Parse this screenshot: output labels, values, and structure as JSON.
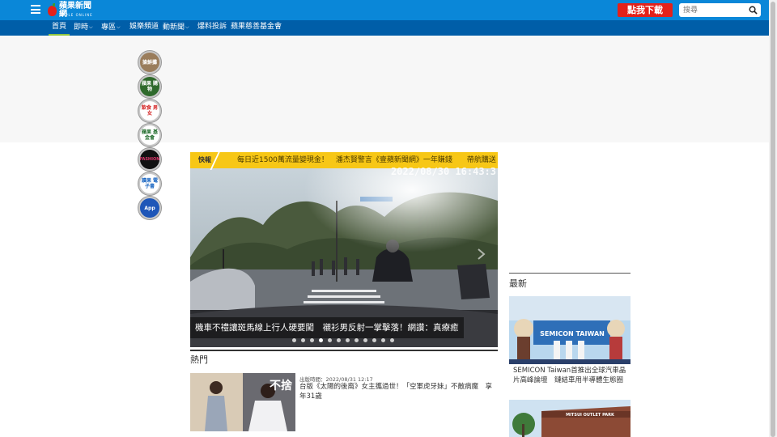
{
  "header": {
    "logo_text": "蘋果新聞網",
    "logo_sub": "APPLE ONLINE",
    "app_button": "點我下載App",
    "search_placeholder": "搜尋"
  },
  "nav": {
    "items": [
      {
        "label": "首頁",
        "active": true
      },
      {
        "label": "即時",
        "dropdown": true
      },
      {
        "label": "專區",
        "dropdown": true
      },
      {
        "label": "娛樂頻道"
      },
      {
        "label": "動新聞",
        "dropdown": true
      },
      {
        "label": "爆料投訴"
      },
      {
        "label": "蘋果慈善基金會"
      }
    ]
  },
  "side_menu": [
    {
      "label": "搶鮮攤"
    },
    {
      "label": "蘋果 購物"
    },
    {
      "label": "飲食 男女"
    },
    {
      "label": "蘋果 基金會"
    },
    {
      "label": "FASHION"
    },
    {
      "label": "讀果 電子書"
    },
    {
      "label": "App"
    }
  ],
  "slider": {
    "ticker_label": "快報",
    "ticker_text": "每日近1500萬流量變現金！　潘杰賢警言《壹蘋新聞網》一年賺錢　　帶航購送",
    "timestamp": "2022/08/30 16:43:3",
    "caption": "機車不禮讓斑馬線上行人硬要闖　襯衫男反射一掌擊落！網讚：真療癒",
    "dot_count": 12,
    "active_dot": 3
  },
  "hot": {
    "title": "熱門",
    "item": {
      "meta": "出版時間：2022/08/31 12:17",
      "headline": "台版《太陽的後裔》女主攜過世！「空軍虎牙妹」不敵病魔　享年31歲",
      "image_text": "不捨"
    }
  },
  "latest": {
    "title": "最新",
    "items": [
      {
        "caption": "SEMICON Taiwan首推出全球汽車晶片高峰論壇　鏈結車用半導體生態圈",
        "image_text": "SEMICON TAIWAN"
      },
      {
        "image_text": "MITSUI OUTLET PARK"
      }
    ]
  }
}
